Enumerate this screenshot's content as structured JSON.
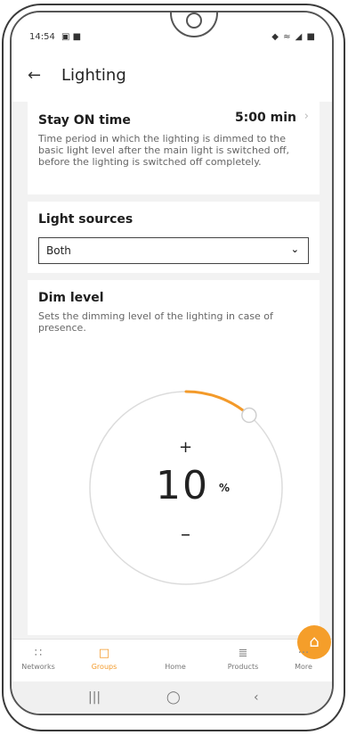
{
  "status_bar": {
    "time": "14:54",
    "left_icons": "▣ ■",
    "right_icons": "◆ ≈ ◢ ■"
  },
  "header": {
    "back_icon": "←",
    "title": "Lighting"
  },
  "stay_on": {
    "label": "Stay ON time",
    "value": "5:00 min",
    "chevron": "›",
    "description": "Time period in which the lighting is dimmed to the basic light level after the main light is switched off, before the lighting is switched off completely."
  },
  "light_sources": {
    "label": "Light sources",
    "selected": "Both",
    "chevron": "⌄"
  },
  "dim_level": {
    "label": "Dim level",
    "description": "Sets the dimming level of the lighting in case of presence.",
    "plus": "+",
    "value": "10",
    "unit": "%",
    "minus": "–",
    "level_percent": 10,
    "accent_color": "#f39a2a"
  },
  "bottom_nav": {
    "items": [
      {
        "label": "Networks",
        "icon": "∷"
      },
      {
        "label": "Groups",
        "icon": "□"
      },
      {
        "label": "Home",
        "icon": "⌂"
      },
      {
        "label": "Products",
        "icon": "≣"
      },
      {
        "label": "More",
        "icon": "···"
      }
    ],
    "active": "Groups"
  },
  "system_nav": {
    "recent": "|||",
    "home": "◯",
    "back": "‹"
  }
}
